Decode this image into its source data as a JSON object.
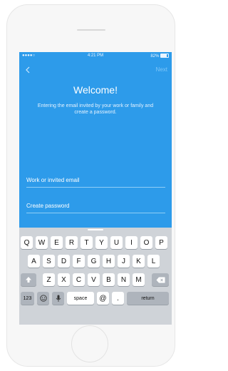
{
  "status": {
    "carrier": "●●●●○",
    "time": "4:21 PM",
    "battery": "82%"
  },
  "nav": {
    "next_label": "Next"
  },
  "welcome": {
    "title": "Welcome!",
    "subtitle": "Entering the email invited by your work or family and create a password."
  },
  "form": {
    "email_placeholder": "Work or invited email",
    "password_placeholder": "Create password"
  },
  "keyboard": {
    "row1": [
      "Q",
      "W",
      "E",
      "R",
      "T",
      "Y",
      "U",
      "I",
      "O",
      "P"
    ],
    "row2": [
      "A",
      "S",
      "D",
      "F",
      "G",
      "H",
      "J",
      "K",
      "L"
    ],
    "row3": [
      "Z",
      "X",
      "C",
      "V",
      "B",
      "N",
      "M"
    ],
    "numbers_label": "123",
    "space_label": "space",
    "at_label": "@",
    "dot_label": ".",
    "return_label": "return"
  },
  "icons": {
    "back": "chevron-left-icon",
    "shift": "shift-icon",
    "backspace": "backspace-icon",
    "emoji": "emoji-icon",
    "mic": "microphone-icon"
  },
  "colors": {
    "accent": "#2d9bea",
    "keyboard_bg": "#cfd3d8"
  }
}
